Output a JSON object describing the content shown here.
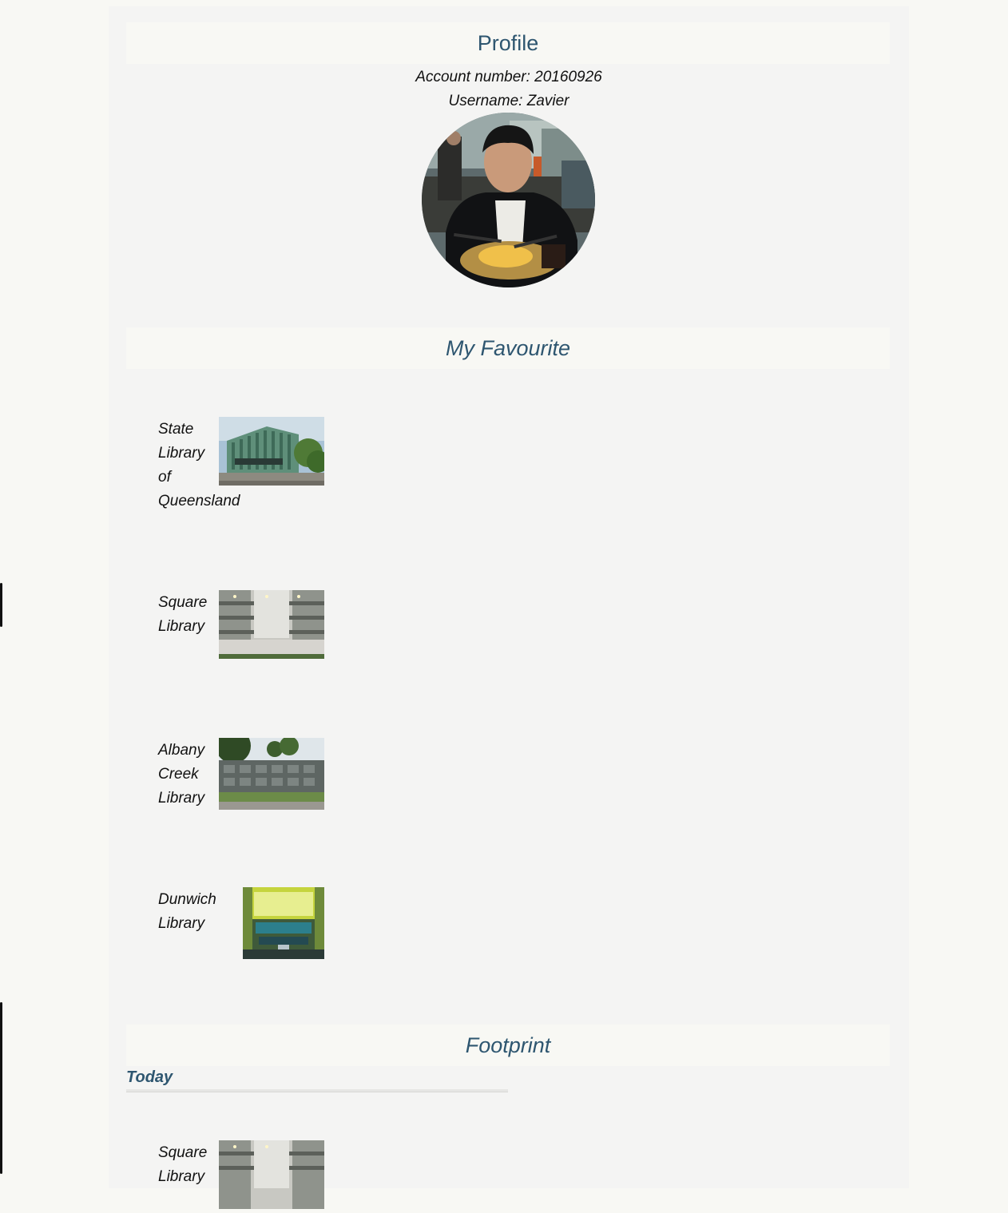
{
  "profile": {
    "title": "Profile",
    "account_number": "Account number: 20160926",
    "username": "Username: Zavier"
  },
  "favourites": {
    "title": "My Favourite",
    "items": [
      {
        "name": "State Library of Queensland",
        "lines": [
          "State",
          "Library",
          "of",
          "Queensland"
        ]
      },
      {
        "name": "Square Library",
        "lines": [
          "Square",
          "Library"
        ]
      },
      {
        "name": "Albany Creek Library",
        "lines": [
          "Albany",
          "Creek",
          "Library"
        ]
      },
      {
        "name": "Dunwich Library",
        "lines": [
          "Dunwich",
          "Library"
        ]
      }
    ]
  },
  "footprint": {
    "title": "Footprint",
    "day": "Today",
    "items": [
      {
        "name": "Square Library",
        "lines": [
          "Square",
          "Library"
        ]
      }
    ]
  },
  "colors": {
    "heading": "#2e5670",
    "page_background": "#f4f4f3",
    "header_band": "#f8f8f4"
  }
}
